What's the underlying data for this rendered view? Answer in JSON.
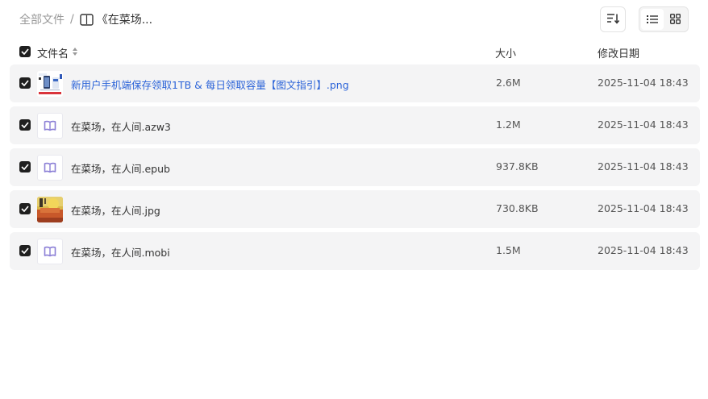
{
  "breadcrumb": {
    "root": "全部文件",
    "separator": "/",
    "current": "《在菜场..."
  },
  "toolbar": {
    "sort_icon": "sort-lines-icon",
    "list_icon": "list-view-icon",
    "grid_icon": "grid-view-icon"
  },
  "header": {
    "name": "文件名",
    "size": "大小",
    "modified": "修改日期"
  },
  "files": [
    {
      "name": "新用户手机端保存领取1TB & 每日领取容量【图文指引】.png",
      "size": "2.6M",
      "date": "2025-11-04 18:43",
      "thumb": "png-thumbnail",
      "checked": true,
      "link": true
    },
    {
      "name": "在菜场，在人间.azw3",
      "size": "1.2M",
      "date": "2025-11-04 18:43",
      "thumb": "ebook-icon",
      "checked": true,
      "link": false
    },
    {
      "name": "在菜场，在人间.epub",
      "size": "937.8KB",
      "date": "2025-11-04 18:43",
      "thumb": "ebook-icon",
      "checked": true,
      "link": false
    },
    {
      "name": "在菜场，在人间.jpg",
      "size": "730.8KB",
      "date": "2025-11-04 18:43",
      "thumb": "jpg-thumbnail",
      "checked": true,
      "link": false
    },
    {
      "name": "在菜场，在人间.mobi",
      "size": "1.5M",
      "date": "2025-11-04 18:43",
      "thumb": "ebook-icon",
      "checked": true,
      "link": false
    }
  ],
  "colors": {
    "row_bg": "#f4f4f5",
    "link": "#2b63d8",
    "checkbox": "#1f1f1f",
    "ebook_icon": "#8b7fd6"
  }
}
